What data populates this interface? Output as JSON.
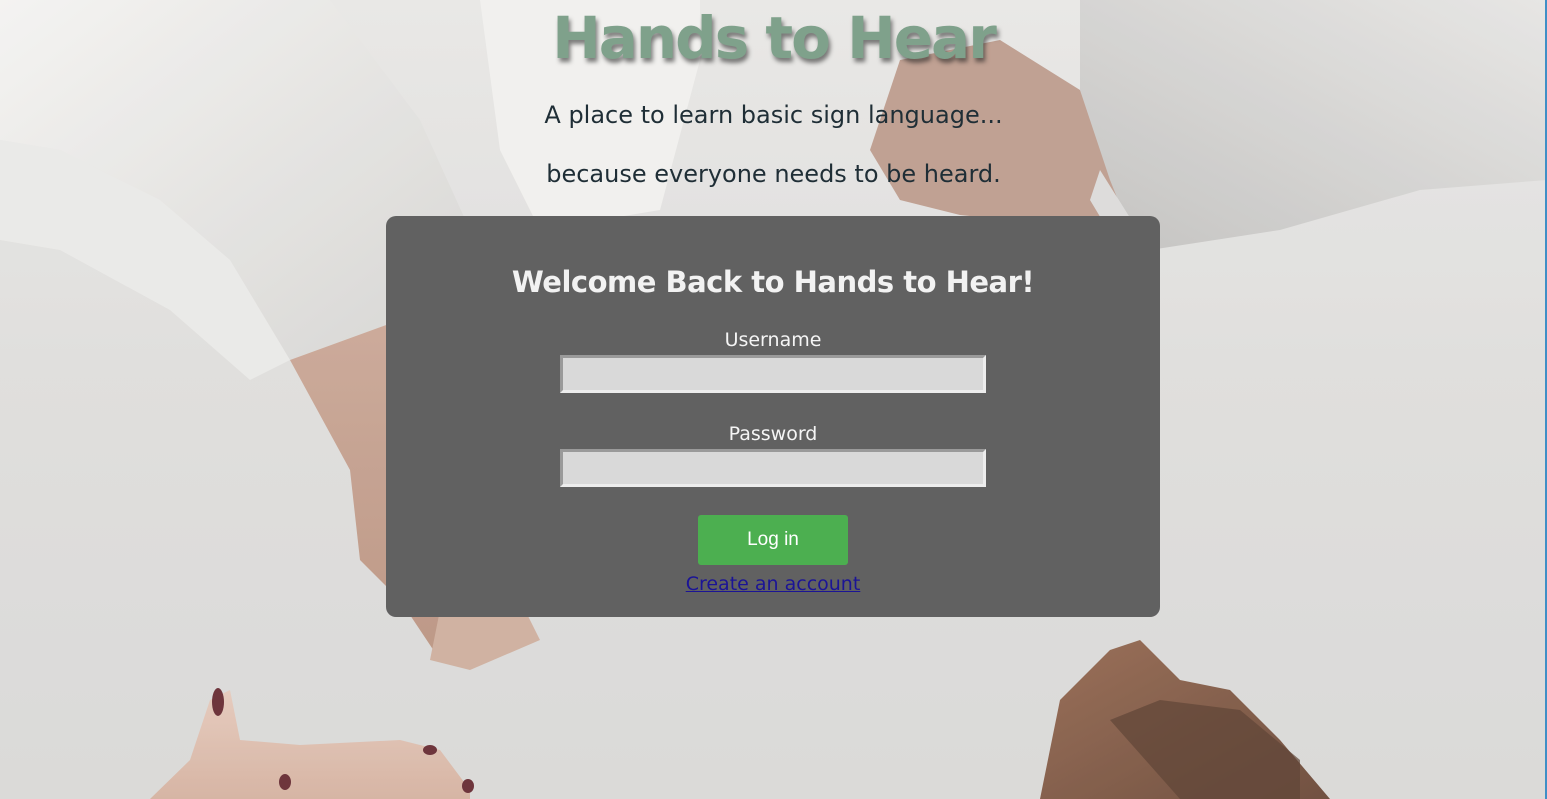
{
  "header": {
    "title": "Hands to Hear",
    "tagline_1": "A place to learn basic sign language...",
    "tagline_2": "because everyone needs to be heard."
  },
  "login": {
    "heading": "Welcome Back to Hands to Hear!",
    "username_label": "Username",
    "username_value": "",
    "password_label": "Password",
    "password_value": "",
    "login_button": "Log in",
    "create_account_link": "Create an account"
  },
  "colors": {
    "title_green": "#7fa18b",
    "card_background": "#616161",
    "button_green": "#4caf50",
    "link_blue": "#1b1496",
    "tagline_text": "#1f2e36"
  },
  "background": {
    "image": "handshake-photo"
  }
}
